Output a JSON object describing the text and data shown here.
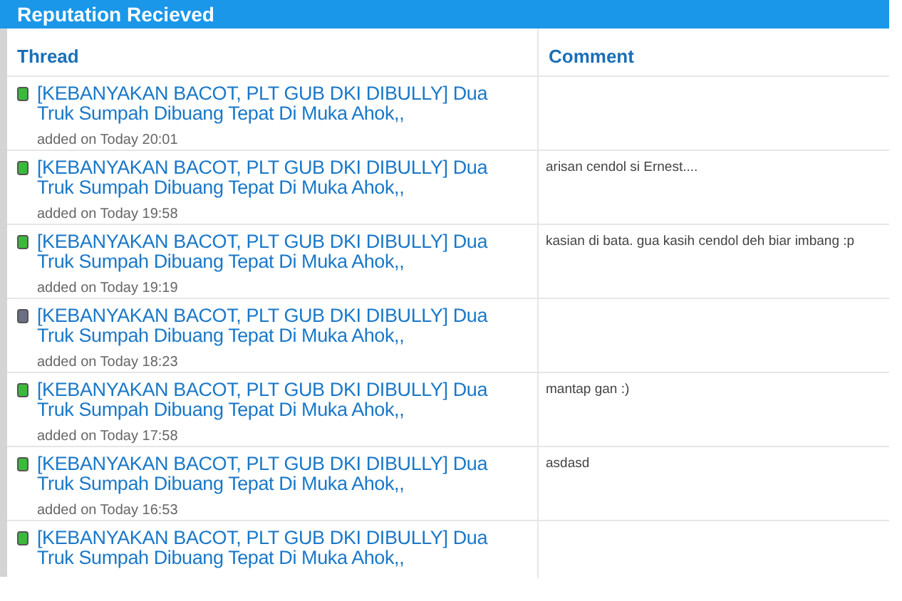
{
  "panel": {
    "title": "Reputation Recieved"
  },
  "table": {
    "columns": [
      "Thread",
      "Comment"
    ],
    "rows": [
      {
        "color": "#3cb93c",
        "thread": "[KEBANYAKAN BACOT, PLT GUB DKI DIBULLY] Dua Truk Sumpah Dibuang Tepat Di Muka Ahok,,",
        "added": "added on Today 20:01"
      },
      {
        "color": "#3cb93c",
        "thread": "[KEBANYAKAN BACOT, PLT GUB DKI DIBULLY] Dua Truk Sumpah Dibuang Tepat Di Muka Ahok,,",
        "added": "added on Today 19:58",
        "comment": "arisan cendol si Ernest...."
      },
      {
        "color": "#3cb93c",
        "thread": "[KEBANYAKAN BACOT, PLT GUB DKI DIBULLY] Dua Truk Sumpah Dibuang Tepat Di Muka Ahok,,",
        "added": "added on Today 19:19",
        "comment": "kasian di bata. gua kasih cendol deh biar imbang :p"
      },
      {
        "color": "#6b6f86",
        "thread": "[KEBANYAKAN BACOT, PLT GUB DKI DIBULLY] Dua Truk Sumpah Dibuang Tepat Di Muka Ahok,,",
        "added": "added on Today 18:23"
      },
      {
        "color": "#3cb93c",
        "thread": "[KEBANYAKAN BACOT, PLT GUB DKI DIBULLY] Dua Truk Sumpah Dibuang Tepat Di Muka Ahok,,",
        "added": "added on Today 17:58",
        "comment": "mantap gan :)"
      },
      {
        "color": "#3cb93c",
        "thread": "[KEBANYAKAN BACOT, PLT GUB DKI DIBULLY] Dua Truk Sumpah Dibuang Tepat Di Muka Ahok,,",
        "added": "added on Today 16:53",
        "comment": "asdasd"
      },
      {
        "color": "#3cb93c",
        "thread": "[KEBANYAKAN BACOT, PLT GUB DKI DIBULLY] Dua Truk Sumpah Dibuang Tepat Di Muka Ahok,,"
      }
    ]
  }
}
